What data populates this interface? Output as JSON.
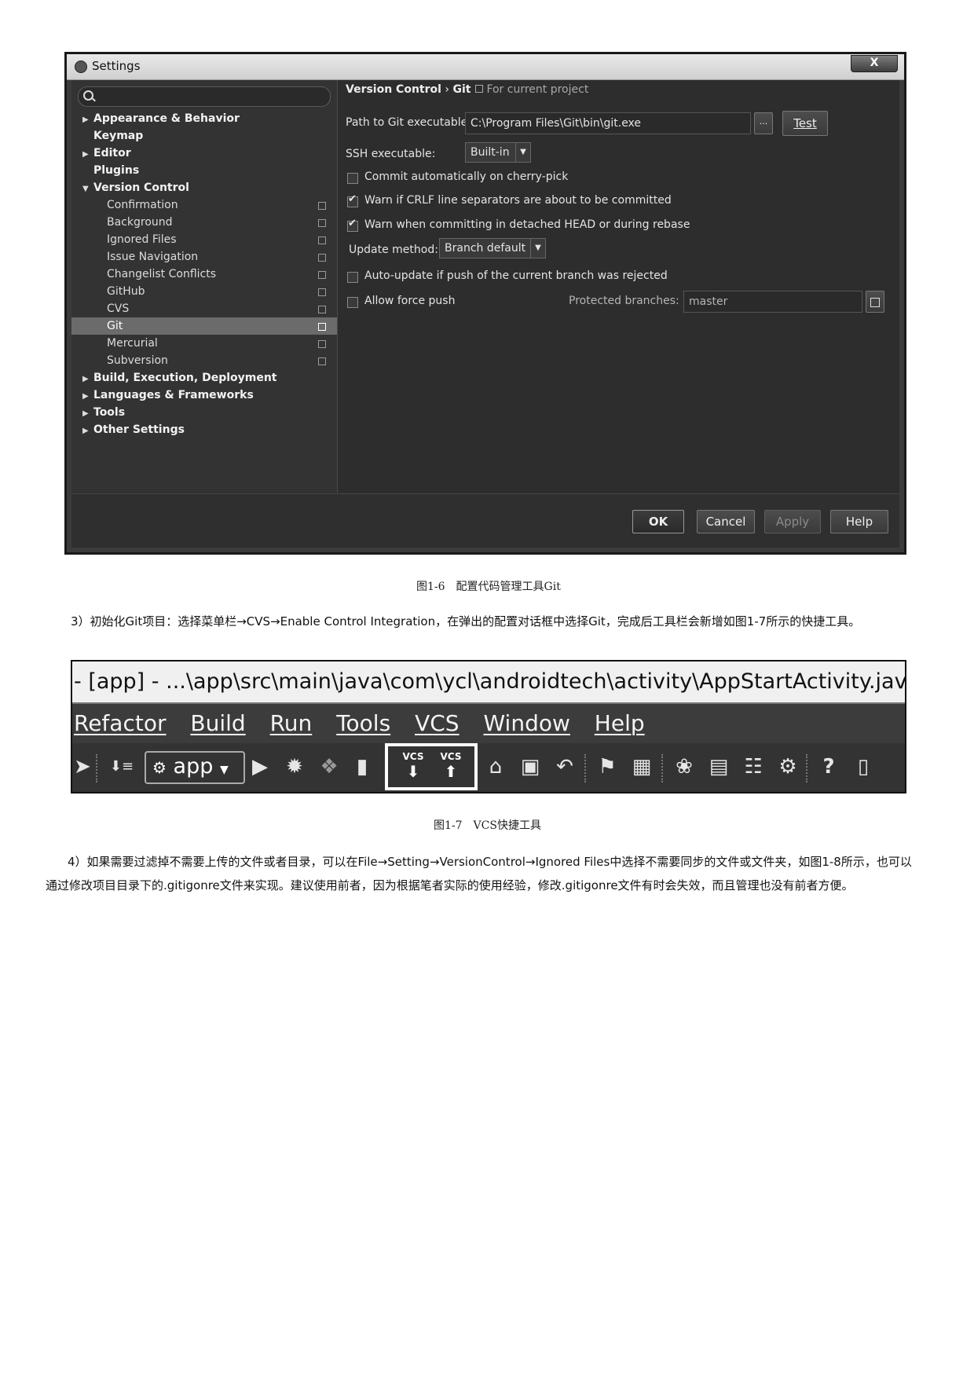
{
  "settings_dialog": {
    "title": "Settings",
    "close_glyph": "X",
    "tree": {
      "top_items": [
        {
          "label": "Appearance & Behavior",
          "arrow": "▶"
        },
        {
          "label": "Keymap",
          "arrow": ""
        },
        {
          "label": "Editor",
          "arrow": "▶"
        },
        {
          "label": "Plugins",
          "arrow": ""
        },
        {
          "label": "Version Control",
          "arrow": "▼"
        }
      ],
      "vc_children": [
        "Confirmation",
        "Background",
        "Ignored Files",
        "Issue Navigation",
        "Changelist Conflicts",
        "GitHub",
        "CVS",
        "Git",
        "Mercurial",
        "Subversion"
      ],
      "selected_child": "Git",
      "bottom_items": [
        {
          "label": "Build, Execution, Deployment",
          "arrow": "▶"
        },
        {
          "label": "Languages & Frameworks",
          "arrow": "▶"
        },
        {
          "label": "Tools",
          "arrow": "▶"
        },
        {
          "label": "Other Settings",
          "arrow": "▶"
        }
      ]
    },
    "breadcrumb": {
      "parent": "Version Control",
      "sep": "›",
      "current": "Git",
      "note": "For current project"
    },
    "git_path_label": "Path to Git executable:",
    "git_path_value": "C:\\Program Files\\Git\\bin\\git.exe",
    "browse_label": "...",
    "test_label": "Test",
    "ssh_label": "SSH executable:",
    "ssh_value": "Built-in",
    "checkboxes": [
      {
        "label": "Commit automatically on cherry-pick",
        "checked": false
      },
      {
        "label": "Warn if CRLF line separators are about to be committed",
        "checked": true
      },
      {
        "label": "Warn when committing in detached HEAD or during rebase",
        "checked": true
      }
    ],
    "update_method_label": "Update method:",
    "update_method_value": "Branch default",
    "auto_update_label": "Auto-update if push of the current branch was rejected",
    "allow_force_label": "Allow force push",
    "protected_label": "Protected branches:",
    "protected_value": "master",
    "dropdown_glyph": "▼",
    "buttons": {
      "ok": "OK",
      "cancel": "Cancel",
      "apply": "Apply",
      "help": "Help"
    }
  },
  "caption_1_6": "图1-6　配置代码管理工具Git",
  "para_3": "3）初始化Git项目：选择菜单栏→CVS→Enable Control Integration，在弹出的配置对话框中选择Git，完成后工具栏会新增如图1-7所示的快捷工具。",
  "ide_strip": {
    "path": "- [app] - ...\\app\\src\\main\\java\\com\\ycl\\androidtech\\activity\\AppStartActivity.java - An",
    "menus": [
      "Refactor",
      "Build",
      "Run",
      "Tools",
      "VCS",
      "Window",
      "Help"
    ],
    "app_config": "app",
    "vcs_label": "VCS",
    "help_glyph": "?"
  },
  "caption_1_7": "图1-7　VCS快捷工具",
  "para_4_line1": "4）如果需要过滤掉不需要上传的文件或者目录，可以在File→Setting→VersionControl→Ignored Files中选择不需要同步的文件或文件夹，如图1-8所示，也可以",
  "para_4_line2": "通过修改项目目录下的.gitigonre文件来实现。建议使用前者，因为根据笔者实际的使用经验，修改.gitigonre文件有时会失效，而且管理也没有前者方便。"
}
